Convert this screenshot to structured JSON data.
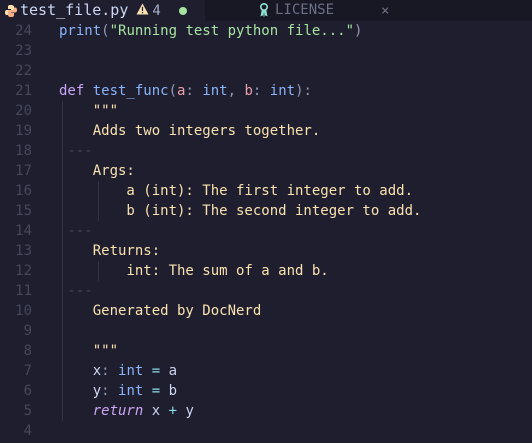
{
  "tabs": [
    {
      "title": "test_file.py",
      "icon": "python-icon",
      "active": true,
      "warning_count": "4",
      "modified": true
    },
    {
      "title": "LICENSE",
      "icon": "license-icon",
      "active": false,
      "close": "×"
    }
  ],
  "colors": {
    "background": "#1e1e2e",
    "tabbar": "#181825",
    "function": "#89b4fa",
    "string": "#a6e3a1",
    "keyword": "#cba6f7",
    "docstring": "#f9e2af",
    "warning": "#f9e2af",
    "modified_dot": "#a6e3a1"
  },
  "editor": {
    "lines": [
      {
        "num": "24",
        "tokens": [
          [
            "fn",
            "print"
          ],
          [
            "punc",
            "("
          ],
          [
            "str",
            "\"Running test python file...\""
          ],
          [
            "punc",
            ")"
          ]
        ]
      },
      {
        "num": "23",
        "tokens": []
      },
      {
        "num": "22",
        "tokens": []
      },
      {
        "num": "21",
        "tokens": [
          [
            "kw",
            "def "
          ],
          [
            "fn",
            "test_func"
          ],
          [
            "punc",
            "("
          ],
          [
            "param",
            "a"
          ],
          [
            "punc",
            ": "
          ],
          [
            "type",
            "int"
          ],
          [
            "punc",
            ", "
          ],
          [
            "param",
            "b"
          ],
          [
            "punc",
            ": "
          ],
          [
            "type",
            "int"
          ],
          [
            "punc",
            "):"
          ]
        ]
      },
      {
        "num": "20",
        "tokens": [
          [
            "doc",
            "    \"\"\""
          ]
        ]
      },
      {
        "num": "19",
        "tokens": [
          [
            "doc",
            "    Adds two integers together."
          ]
        ]
      },
      {
        "num": "18",
        "tokens": [
          [
            "sep",
            " ---"
          ]
        ]
      },
      {
        "num": "17",
        "tokens": [
          [
            "doc",
            "    Args:"
          ]
        ]
      },
      {
        "num": "16",
        "tokens": [
          [
            "doc",
            "        a (int): The first integer to add."
          ]
        ]
      },
      {
        "num": "15",
        "tokens": [
          [
            "doc",
            "        b (int): The second integer to add."
          ]
        ]
      },
      {
        "num": "14",
        "tokens": [
          [
            "sep",
            " ---"
          ]
        ]
      },
      {
        "num": "13",
        "tokens": [
          [
            "doc",
            "    Returns:"
          ]
        ]
      },
      {
        "num": "12",
        "tokens": [
          [
            "doc",
            "        int: The sum of a and b."
          ]
        ]
      },
      {
        "num": "11",
        "tokens": [
          [
            "sep",
            " ---"
          ]
        ]
      },
      {
        "num": "10",
        "tokens": [
          [
            "doc",
            "    Generated by DocNerd"
          ]
        ]
      },
      {
        "num": "9",
        "tokens": []
      },
      {
        "num": "8",
        "tokens": [
          [
            "doc",
            "    \"\"\""
          ]
        ]
      },
      {
        "num": "7",
        "tokens": [
          [
            "var",
            "    x"
          ],
          [
            "punc",
            ": "
          ],
          [
            "type",
            "int"
          ],
          [
            "op",
            " = "
          ],
          [
            "var",
            "a"
          ]
        ]
      },
      {
        "num": "6",
        "tokens": [
          [
            "var",
            "    y"
          ],
          [
            "punc",
            ": "
          ],
          [
            "type",
            "int"
          ],
          [
            "op",
            " = "
          ],
          [
            "var",
            "b"
          ]
        ]
      },
      {
        "num": "5",
        "tokens": [
          [
            "kwit",
            "    return"
          ],
          [
            "var",
            " x "
          ],
          [
            "op",
            "+"
          ],
          [
            "var",
            " y"
          ]
        ]
      },
      {
        "num": "4",
        "tokens": []
      }
    ]
  }
}
